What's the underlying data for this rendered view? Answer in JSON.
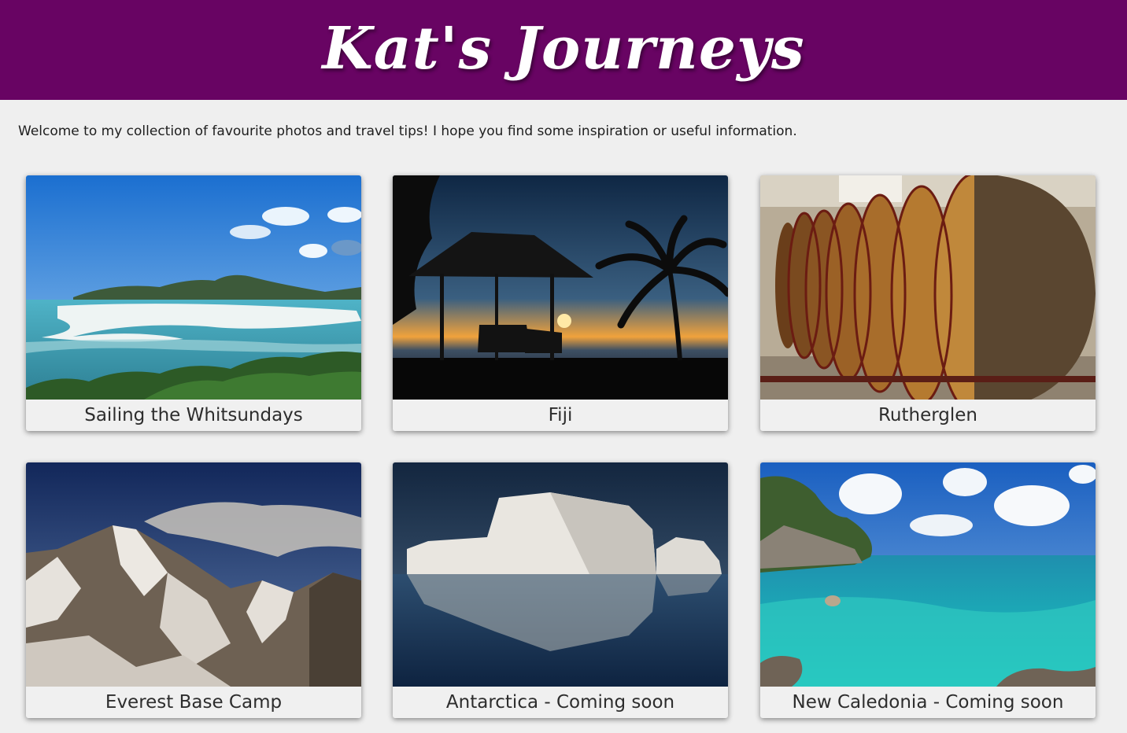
{
  "header": {
    "title": "Kat's Journeys",
    "background": "#680463"
  },
  "intro": {
    "text": "Welcome to my collection of favourite photos and travel tips! I hope you find some inspiration or useful information."
  },
  "cards": [
    {
      "caption": "Sailing the Whitsundays",
      "photo": "whitsundays-beach-photo"
    },
    {
      "caption": "Fiji",
      "photo": "fiji-sunset-hut-photo"
    },
    {
      "caption": "Rutherglen",
      "photo": "wine-barrels-photo"
    },
    {
      "caption": "Everest Base Camp",
      "photo": "everest-mountain-photo"
    },
    {
      "caption": "Antarctica - Coming soon",
      "photo": "iceberg-photo"
    },
    {
      "caption": "New Caledonia - Coming soon",
      "photo": "turquoise-lagoon-photo"
    }
  ]
}
